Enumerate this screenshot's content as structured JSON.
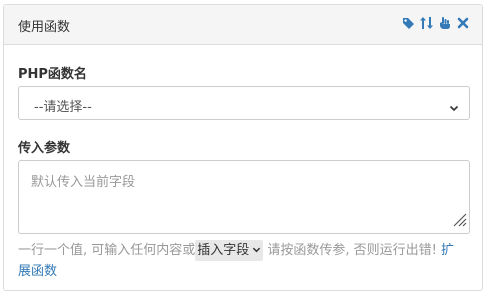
{
  "panel": {
    "title": "使用函数",
    "tools": [
      "tag-icon",
      "sort-icon",
      "hand-icon",
      "close-icon"
    ]
  },
  "php_function": {
    "label": "PHP函数名",
    "selected": "--请选择--"
  },
  "params": {
    "label": "传入参数",
    "placeholder": "默认传入当前字段"
  },
  "help": {
    "text_before": "一行一个值, 可输入任何内容或",
    "insert_field_select": "插入字段",
    "text_after": " 请按函数传参, 否则运行出错!",
    "link": "扩展函数"
  },
  "colors": {
    "tool_icon": "#337ab7",
    "link": "#337ab7",
    "heading_bg": "#f5f5f5"
  }
}
